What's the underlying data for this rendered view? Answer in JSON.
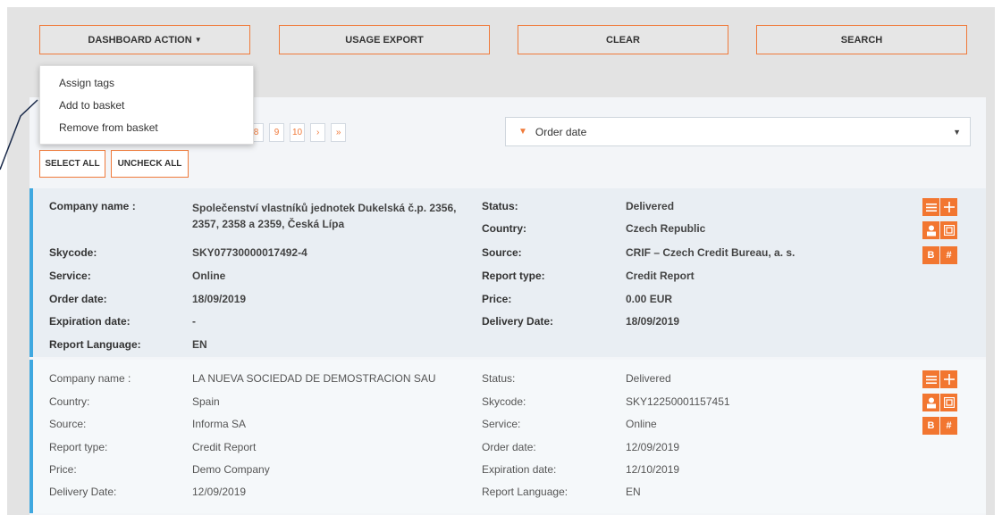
{
  "toolbar": {
    "dashboard_action": "DASHBOARD ACTION",
    "usage_export": "USAGE EXPORT",
    "clear": "CLEAR",
    "search": "SEARCH"
  },
  "dropdown": {
    "items": [
      "Assign tags",
      "Add to basket",
      "Remove from basket"
    ]
  },
  "pagination": {
    "pages": [
      "8",
      "9",
      "10",
      "›",
      "»"
    ]
  },
  "sort": {
    "selected": "Order date"
  },
  "selection": {
    "select_all": "SELECT ALL",
    "uncheck_all": "UNCHECK ALL"
  },
  "records": [
    {
      "company_label": "Company name :",
      "company_value": "Společenství vlastníků jednotek Dukelská č.p. 2356, 2357, 2358 a 2359, Česká Lípa",
      "left": [
        {
          "label": "Skycode:",
          "value": "SKY07730000017492-4"
        },
        {
          "label": "Service:",
          "value": "Online"
        },
        {
          "label": "Order date:",
          "value": "18/09/2019"
        },
        {
          "label": "Expiration date:",
          "value": "-"
        },
        {
          "label": "Report Language:",
          "value": "EN"
        }
      ],
      "right": [
        {
          "label": "Status:",
          "value": "Delivered"
        },
        {
          "label": "Country:",
          "value": "Czech Republic"
        },
        {
          "label": "Source:",
          "value": "CRIF – Czech Credit Bureau, a. s."
        },
        {
          "label": "Report type:",
          "value": "Credit Report"
        },
        {
          "label": "Price:",
          "value": "0.00 EUR"
        },
        {
          "label": "Delivery Date:",
          "value": "18/09/2019"
        }
      ]
    },
    {
      "company_label": "Company name :",
      "company_value": "LA NUEVA SOCIEDAD DE DEMOSTRACION SAU",
      "left": [
        {
          "label": "Country:",
          "value": "Spain"
        },
        {
          "label": "Source:",
          "value": "Informa SA"
        },
        {
          "label": "Report type:",
          "value": "Credit Report"
        },
        {
          "label": "Price:",
          "value": "Demo Company"
        },
        {
          "label": "Delivery Date:",
          "value": "12/09/2019"
        }
      ],
      "right": [
        {
          "label": "Status:",
          "value": "Delivered"
        },
        {
          "label": "Skycode:",
          "value": "SKY12250001157451"
        },
        {
          "label": "Service:",
          "value": "Online"
        },
        {
          "label": "Order date:",
          "value": "12/09/2019"
        },
        {
          "label": "Expiration date:",
          "value": "12/10/2019"
        },
        {
          "label": "Report Language:",
          "value": "EN"
        }
      ]
    }
  ],
  "actions": {
    "b_label": "B",
    "hash_label": "#",
    "icons": [
      "list-icon",
      "plus-icon",
      "person-icon",
      "print-icon"
    ]
  },
  "colors": {
    "accent": "#f27630",
    "record_border": "#3fa8e0",
    "callout_line": "#1a2a4a"
  }
}
